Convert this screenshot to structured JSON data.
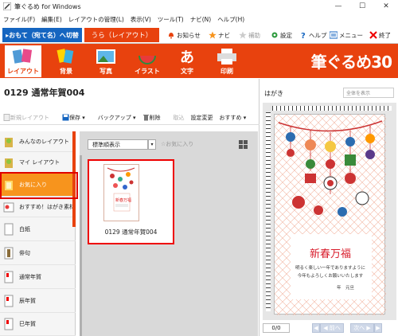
{
  "window": {
    "title": "筆ぐるめ for Windows",
    "minimize": "—",
    "maximize": "☐",
    "close": "✕"
  },
  "menu": [
    "ファイル(F)",
    "編集(E)",
    "レイアウトの管理(L)",
    "表示(V)",
    "ツール(T)",
    "ナビ(N)",
    "ヘルプ(H)"
  ],
  "mode_tabs": {
    "front": "▸おもて（宛て名）へ切替",
    "back": "うら（レイアウト）"
  },
  "toolbar1": [
    {
      "name": "notice",
      "label": "お知らせ",
      "icon": "bell-icon"
    },
    {
      "name": "navi",
      "label": "ナビ",
      "icon": "star-icon"
    },
    {
      "name": "assist",
      "label": "補助",
      "icon": "star-outline-icon",
      "disabled": true
    },
    {
      "name": "settings",
      "label": "設定",
      "icon": "gear-icon"
    },
    {
      "name": "help",
      "label": "ヘルプ",
      "icon": "question-icon"
    },
    {
      "name": "menu",
      "label": "メニュー",
      "icon": "menu-icon"
    },
    {
      "name": "exit",
      "label": "終了",
      "icon": "close-icon"
    }
  ],
  "ribbon": {
    "buttons": [
      {
        "name": "layout",
        "label": "レイアウト",
        "active": true
      },
      {
        "name": "background",
        "label": "背景"
      },
      {
        "name": "photo",
        "label": "写真"
      },
      {
        "name": "illust",
        "label": "イラスト"
      },
      {
        "name": "text",
        "label": "文字"
      },
      {
        "name": "print",
        "label": "印刷"
      }
    ],
    "logo": "筆ぐるめ30"
  },
  "document": {
    "title": "0129 通常年賀004"
  },
  "toolbar2": [
    {
      "name": "new-layout",
      "label": "新規レイアウト",
      "disabled": true
    },
    {
      "name": "save",
      "label": "保存 ▾"
    },
    {
      "name": "backup",
      "label": "バックアップ ▾"
    },
    {
      "name": "delete",
      "label": "削除"
    },
    {
      "name": "import",
      "label": "取込",
      "disabled": true
    },
    {
      "name": "settings-change",
      "label": "設定変更"
    },
    {
      "name": "recommend",
      "label": "おすすめ ▾"
    }
  ],
  "categories": [
    {
      "label": "みんなのレイアウト"
    },
    {
      "label": "マイ レイアウト"
    },
    {
      "label": "お気に入り",
      "selected": true
    },
    {
      "label": "おすすめ！はがき素材"
    },
    {
      "label": "白紙"
    },
    {
      "label": "俳句"
    },
    {
      "label": "通常年賀"
    },
    {
      "label": "辰年賀"
    },
    {
      "label": "巳年賀"
    }
  ],
  "content": {
    "sort": "標準順表示",
    "favorite": "☆お気に入り",
    "item": {
      "caption": "0129 通常年賀004"
    }
  },
  "preview": {
    "title": "はがき",
    "display_select": "全体を表示",
    "card": {
      "greeting": "新春万福",
      "message_line1": "明るく楽しい一年でありますように",
      "message_line2": "今年もよろしくお願いいたします",
      "date": "年　元旦"
    },
    "page": "0/0",
    "prev": "◀ 前へ",
    "next": "次へ ▶"
  }
}
